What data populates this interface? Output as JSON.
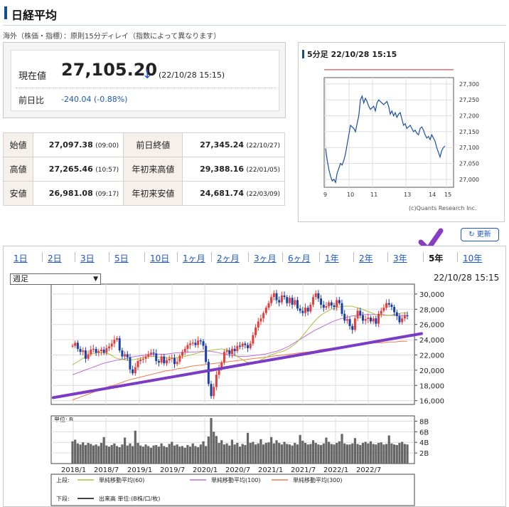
{
  "header": {
    "title": "日経平均"
  },
  "note": "海外（株価・指標）：原則15分ディレイ（指数によって異なります）",
  "quote": {
    "current_label": "現在値",
    "current_value": "27,105.20",
    "direction_icon": "down-arrow-icon",
    "timestamp": "(22/10/28 15:15)",
    "change_label": "前日比",
    "change_value": "-240.04 (-0.88%)"
  },
  "ohlc": [
    {
      "l1": "始値",
      "v1": "27,097.38",
      "t1": "(09:00)",
      "l2": "前日終値",
      "v2": "27,345.24",
      "t2": "(22/10/27)"
    },
    {
      "l1": "高値",
      "v1": "27,265.46",
      "t1": "(10:57)",
      "l2": "年初来高値",
      "v2": "29,388.16",
      "t2": "(22/01/05)"
    },
    {
      "l1": "安値",
      "v1": "26,981.08",
      "t1": "(09:17)",
      "l2": "年初来安値",
      "v2": "24,681.74",
      "t2": "(22/03/09)"
    }
  ],
  "mini_chart": {
    "title": "5分足 22/10/28 15:15",
    "credit": "(c)Quants Research Inc."
  },
  "refresh_label": "更新",
  "tabs": [
    "1日",
    "2日",
    "3日",
    "5日",
    "10日",
    "1ヶ月",
    "2ヶ月",
    "3ヶ月",
    "6ヶ月",
    "1年",
    "2年",
    "3年",
    "5年",
    "10年"
  ],
  "active_tab": "5年",
  "period_select": {
    "value": "週足"
  },
  "chart_timestamp": "22/10/28 15:15",
  "volume_unit": "単位: B",
  "legend": {
    "upper_label": "上段:",
    "ma60": "単純移動平均(60)",
    "ma100": "単純移動平均(100)",
    "ma300": "単純移動平均(300)",
    "lower_label": "下段:",
    "volume": "出来高 単位:(B株/口/枚)"
  },
  "colors": {
    "up": "#e63c3c",
    "down": "#1a3fa6",
    "ma60": "#a8c23a",
    "ma100": "#c06bd6",
    "ma300": "#f07a4a",
    "trend": "#7a3cc4",
    "accent": "#1a56c4"
  },
  "chart_data": [
    {
      "type": "line",
      "title": "5分足 22/10/28 15:15",
      "x_ticks": [
        "9",
        "10",
        "11",
        "13",
        "14",
        "15"
      ],
      "y_ticks": [
        "27,000",
        "27,050",
        "27,100",
        "27,150",
        "27,200",
        "27,250",
        "27,300"
      ],
      "ylim": [
        26975,
        27320
      ],
      "series": [
        {
          "values": [
            27097,
            27060,
            27030,
            27010,
            26995,
            27000,
            26990,
            27020,
            27035,
            27050,
            27045,
            27060,
            27080,
            27110,
            27140,
            27170,
            27165,
            27160,
            27150,
            27175,
            27200,
            27250,
            27262,
            27240,
            27255,
            27245,
            27230,
            27220,
            27225,
            27230,
            27215,
            27240,
            27250,
            27245,
            27240,
            27235,
            27240,
            27245,
            27230,
            27205,
            27215,
            27200,
            27210,
            27195,
            27205,
            27210,
            27190,
            27170,
            27175,
            27160,
            27165,
            27170,
            27160,
            27150,
            27155,
            27145,
            27140,
            27160,
            27165,
            27155,
            27140,
            27130,
            27135,
            27125,
            27140,
            27130,
            27120,
            27100,
            27085,
            27070,
            27090,
            27100,
            27105
          ]
        }
      ],
      "reference_line": 27345
    },
    {
      "type": "line",
      "x_ticks": [
        "2018/1",
        "2018/7",
        "2019/1",
        "2019/7",
        "2020/1",
        "2020/7",
        "2021/1",
        "2021/7",
        "2022/1",
        "2022/7"
      ],
      "y_ticks": [
        "16,000",
        "18,000",
        "20,000",
        "22,000",
        "24,000",
        "26,000",
        "28,000",
        "30,000"
      ],
      "ylim": [
        15500,
        31300
      ],
      "series": [
        {
          "values": [
            23200,
            23600,
            22800,
            22400,
            22600,
            21500,
            22100,
            22700,
            22800,
            22300,
            22500,
            22700,
            22300,
            22900,
            23100,
            23500,
            24000,
            24200,
            22600,
            21800,
            22100,
            21700,
            20100,
            19600,
            20400,
            21200,
            21400,
            21500,
            21800,
            22100,
            22300,
            22200,
            21200,
            21000,
            21800,
            20900,
            21300,
            21500,
            21600,
            20800,
            21100,
            21900,
            22400,
            22800,
            23300,
            23500,
            23600,
            23300,
            23900,
            23800,
            23200,
            21100,
            18200,
            16600,
            17800,
            19400,
            20200,
            21000,
            22400,
            22600,
            22100,
            22800,
            22500,
            23200,
            23100,
            23500,
            23300,
            22900,
            23500,
            24600,
            25600,
            26400,
            26800,
            27500,
            28200,
            28800,
            29600,
            30100,
            29200,
            28900,
            29800,
            29600,
            28800,
            29500,
            28600,
            29200,
            28100,
            27800,
            27500,
            28200,
            27700,
            28600,
            29600,
            30100,
            29400,
            28600,
            28200,
            28400,
            28900,
            28500,
            28300,
            29200,
            28800,
            27400,
            26500,
            26700,
            25800,
            25300,
            26800,
            27800,
            27200,
            26500,
            26700,
            26900,
            26400,
            26800,
            26100,
            27400,
            27800,
            28200,
            28800,
            28600,
            28300,
            27600,
            27100,
            26300,
            26800,
            27200,
            27100
          ]
        },
        {
          "name": "単純移動平均(60)",
          "values": [
            20700,
            21200,
            21700,
            22100,
            22300,
            22300,
            22100,
            21600,
            21400,
            21300,
            21400,
            21600,
            21800,
            21800,
            21700,
            21700,
            21600,
            21700,
            21800,
            22000,
            22200,
            22400,
            22600,
            22700,
            22800,
            22700,
            22100,
            21600,
            21100,
            20900,
            21200,
            21600,
            22000,
            22300,
            22500,
            22900,
            23500,
            24400,
            25400,
            26400,
            27200,
            27700,
            28100,
            28300,
            28400,
            28400,
            28200,
            27900,
            27600,
            27300,
            27200,
            27200,
            27300,
            27500,
            27500
          ]
        },
        {
          "name": "単純移動平均(100)",
          "values": [
            19400,
            19700,
            20000,
            20300,
            20600,
            20900,
            21100,
            21300,
            21400,
            21600,
            21800,
            21900,
            22000,
            22100,
            22100,
            22100,
            22200,
            22300,
            22300,
            22400,
            22400,
            22500,
            22500,
            22400,
            22200,
            22000,
            21900,
            21800,
            21800,
            21900,
            22000,
            22100,
            22300,
            22500,
            22800,
            23200,
            23700,
            24200,
            24700,
            25200,
            25600,
            26000,
            26400,
            26700,
            26900,
            27100,
            27200,
            27300,
            27300,
            27300,
            27300,
            27200,
            27200,
            27200,
            27200
          ]
        },
        {
          "name": "単純移動平均(300)",
          "values": [
            16100,
            16400,
            16700,
            17000,
            17300,
            17600,
            17900,
            18100,
            18400,
            18700,
            18900,
            19100,
            19300,
            19500,
            19700,
            19900,
            20000,
            20200,
            20300,
            20500,
            20600,
            20700,
            20800,
            20900,
            21000,
            21100,
            21200,
            21300,
            21400,
            21500,
            21600,
            21700,
            21800,
            21900,
            22000,
            22100,
            22200,
            22300,
            22400,
            22500,
            22700,
            22800,
            22900,
            23000,
            23100,
            23200,
            23300,
            23400,
            23500,
            23600,
            23600,
            23700,
            23700,
            23800,
            23800
          ]
        }
      ],
      "trend_line": [
        16400,
        24800
      ]
    },
    {
      "type": "bar",
      "title": "単位: B",
      "y_ticks": [
        "2B",
        "4B",
        "6B",
        "8B"
      ],
      "ylim": [
        0,
        9
      ],
      "values": [
        4.2,
        4.5,
        3.8,
        3.6,
        4.0,
        3.5,
        3.9,
        3.7,
        3.4,
        3.6,
        3.3,
        3.9,
        5.0,
        3.4,
        3.2,
        3.5,
        3.8,
        3.3,
        3.1,
        3.6,
        4.9,
        3.4,
        3.8,
        3.3,
        6.2,
        3.9,
        3.4,
        3.2,
        3.6,
        3.3,
        3.0,
        3.4,
        3.5,
        3.2,
        3.8,
        3.3,
        3.1,
        3.7,
        4.1,
        3.4,
        3.6,
        3.2,
        3.3,
        3.0,
        3.5,
        3.2,
        3.8,
        3.3,
        3.1,
        3.6,
        4.2,
        3.3,
        5.1,
        8.6,
        6.0,
        5.2,
        3.9,
        4.4,
        3.6,
        3.8,
        3.4,
        4.5,
        3.6,
        3.9,
        3.2,
        3.7,
        3.5,
        5.8,
        3.9,
        4.1,
        3.6,
        3.8,
        4.6,
        3.6,
        3.9,
        4.0,
        5.0,
        3.8,
        4.4,
        3.9,
        3.6,
        4.1,
        3.7,
        3.6,
        3.4,
        3.9,
        3.6,
        5.4,
        4.3,
        3.9,
        3.6,
        3.7,
        4.4,
        3.9,
        3.6,
        3.5,
        3.8,
        4.9,
        4.1,
        3.7,
        3.6,
        3.9,
        4.2,
        5.6,
        3.8,
        3.6,
        3.6,
        3.8,
        4.8,
        3.7,
        3.5,
        3.9,
        4.1,
        3.8,
        4.2,
        3.7,
        3.6,
        3.9,
        4.0,
        3.6,
        3.7,
        5.3,
        3.8,
        3.6,
        3.5,
        3.9,
        4.1,
        3.7,
        3.6
      ]
    }
  ]
}
